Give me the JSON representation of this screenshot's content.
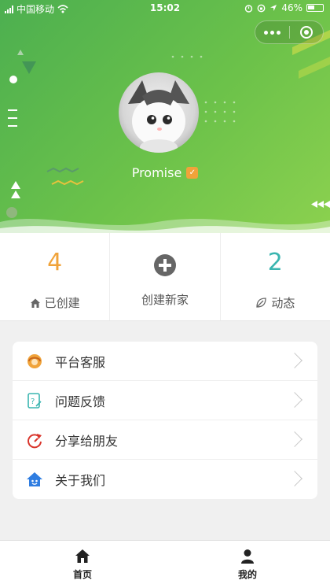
{
  "status_bar": {
    "carrier": "中国移动",
    "time": "15:02",
    "battery": "46%"
  },
  "profile": {
    "username": "Promise",
    "badge_icon": "verified-badge-icon"
  },
  "stats": [
    {
      "value": "4",
      "label": "已创建",
      "icon": "home-icon",
      "color": "#f0a33a"
    },
    {
      "label": "创建新家",
      "icon": "plus-circle-icon"
    },
    {
      "value": "2",
      "label": "动态",
      "icon": "leaf-icon",
      "color": "#3ab5b0"
    }
  ],
  "menu": [
    {
      "label": "平台客服",
      "icon": "customer-service-icon"
    },
    {
      "label": "问题反馈",
      "icon": "feedback-icon"
    },
    {
      "label": "分享给朋友",
      "icon": "share-icon"
    },
    {
      "label": "关于我们",
      "icon": "about-house-icon"
    }
  ],
  "tabbar": [
    {
      "label": "首页",
      "icon": "home-tab-icon"
    },
    {
      "label": "我的",
      "icon": "user-tab-icon"
    }
  ],
  "colors": {
    "header_green": "#6cc24a",
    "accent_orange": "#f0a33a",
    "accent_teal": "#3ab5b0"
  }
}
